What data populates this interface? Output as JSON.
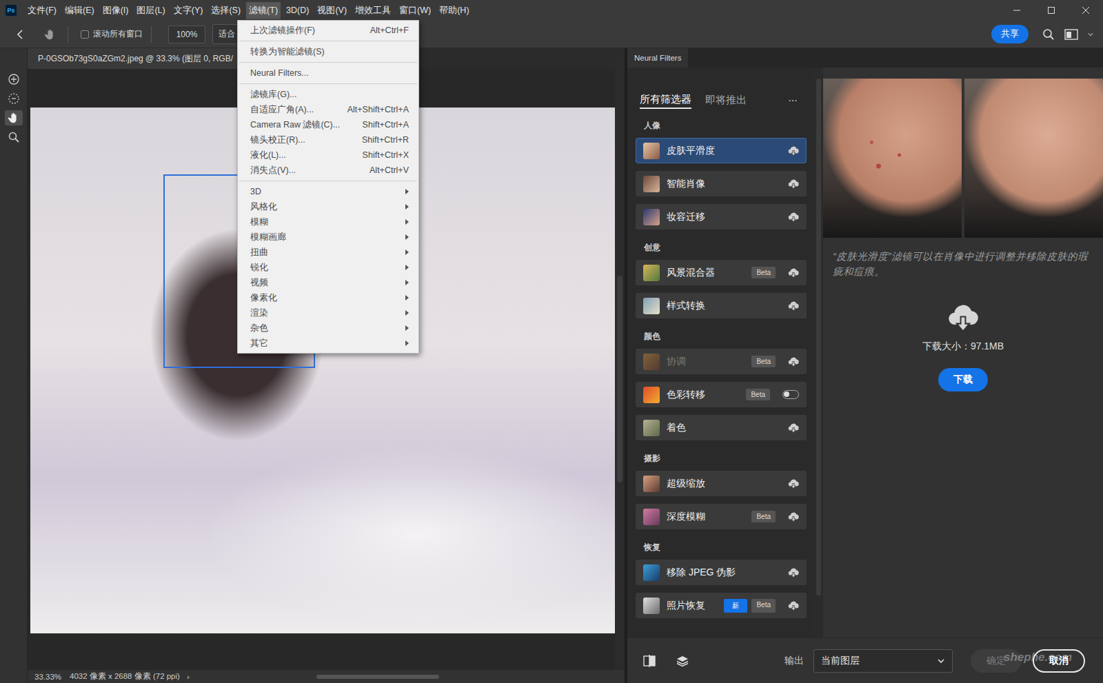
{
  "app": {
    "logo": "Ps"
  },
  "menubar": [
    {
      "label": "文件(F)",
      "selected": false
    },
    {
      "label": "编辑(E)",
      "selected": false
    },
    {
      "label": "图像(I)",
      "selected": false
    },
    {
      "label": "图层(L)",
      "selected": false
    },
    {
      "label": "文字(Y)",
      "selected": false
    },
    {
      "label": "选择(S)",
      "selected": false
    },
    {
      "label": "滤镜(T)",
      "selected": true
    },
    {
      "label": "3D(D)",
      "selected": false
    },
    {
      "label": "视图(V)",
      "selected": false
    },
    {
      "label": "增效工具",
      "selected": false
    },
    {
      "label": "窗口(W)",
      "selected": false
    },
    {
      "label": "帮助(H)",
      "selected": false
    }
  ],
  "options_bar": {
    "scroll_all_windows": {
      "label": "滚动所有窗口",
      "checked": false
    },
    "zoom": "100%",
    "fit": "适合",
    "share": "共享"
  },
  "toolbar": [
    {
      "kind": "target",
      "selected": false
    },
    {
      "kind": "lasso",
      "selected": false
    },
    {
      "kind": "hand",
      "selected": true
    },
    {
      "kind": "zoom",
      "selected": false
    }
  ],
  "document": {
    "tab": "P-0GSOb73gS0aZGm2.jpeg @ 33.3% (图层 0, RGB/",
    "zoom": "33.33%",
    "dimensions": "4032 像素 x 2688 像素 (72 ppi)",
    "more": "›"
  },
  "filter_menu": {
    "groups": [
      [
        {
          "label": "上次滤镜操作(F)",
          "shortcut": "Alt+Ctrl+F",
          "submenu": false
        }
      ],
      [
        {
          "label": "转换为智能滤镜(S)",
          "shortcut": "",
          "submenu": false
        }
      ],
      [
        {
          "label": "Neural Filters...",
          "shortcut": "",
          "submenu": false
        }
      ],
      [
        {
          "label": "滤镜库(G)...",
          "shortcut": "",
          "submenu": false
        },
        {
          "label": "自适应广角(A)...",
          "shortcut": "Alt+Shift+Ctrl+A",
          "submenu": false
        },
        {
          "label": "Camera Raw 滤镜(C)...",
          "shortcut": "Shift+Ctrl+A",
          "submenu": false
        },
        {
          "label": "镜头校正(R)...",
          "shortcut": "Shift+Ctrl+R",
          "submenu": false
        },
        {
          "label": "液化(L)...",
          "shortcut": "Shift+Ctrl+X",
          "submenu": false
        },
        {
          "label": "消失点(V)...",
          "shortcut": "Alt+Ctrl+V",
          "submenu": false
        }
      ],
      [
        {
          "label": "3D",
          "shortcut": "",
          "submenu": true
        },
        {
          "label": "风格化",
          "shortcut": "",
          "submenu": true
        },
        {
          "label": "模糊",
          "shortcut": "",
          "submenu": true
        },
        {
          "label": "模糊画廊",
          "shortcut": "",
          "submenu": true
        },
        {
          "label": "扭曲",
          "shortcut": "",
          "submenu": true
        },
        {
          "label": "锐化",
          "shortcut": "",
          "submenu": true
        },
        {
          "label": "视频",
          "shortcut": "",
          "submenu": true
        },
        {
          "label": "像素化",
          "shortcut": "",
          "submenu": true
        },
        {
          "label": "渲染",
          "shortcut": "",
          "submenu": true
        },
        {
          "label": "杂色",
          "shortcut": "",
          "submenu": true
        },
        {
          "label": "其它",
          "shortcut": "",
          "submenu": true
        }
      ]
    ]
  },
  "neural_filters": {
    "panel_tab": "Neural Filters",
    "tabs": [
      {
        "label": "所有筛选器",
        "selected": true
      },
      {
        "label": "即将推出",
        "selected": false
      }
    ],
    "more": "···",
    "categories": [
      {
        "title": "人像",
        "filters": [
          {
            "name": "皮肤平滑度",
            "selected": true,
            "disabled": false,
            "badges": [],
            "kind": "download"
          },
          {
            "name": "智能肖像",
            "selected": false,
            "disabled": false,
            "badges": [],
            "kind": "download"
          },
          {
            "name": "妆容迁移",
            "selected": false,
            "disabled": false,
            "badges": [],
            "kind": "download"
          }
        ]
      },
      {
        "title": "创意",
        "filters": [
          {
            "name": "风景混合器",
            "selected": false,
            "disabled": false,
            "badges": [
              {
                "label": "Beta",
                "kind": "beta"
              }
            ],
            "kind": "download"
          },
          {
            "name": "样式转换",
            "selected": false,
            "disabled": false,
            "badges": [],
            "kind": "download"
          }
        ]
      },
      {
        "title": "颜色",
        "filters": [
          {
            "name": "协调",
            "selected": false,
            "disabled": true,
            "badges": [
              {
                "label": "Beta",
                "kind": "beta"
              }
            ],
            "kind": "download"
          },
          {
            "name": "色彩转移",
            "selected": false,
            "disabled": false,
            "badges": [
              {
                "label": "Beta",
                "kind": "beta"
              }
            ],
            "kind": "toggle",
            "on": false
          },
          {
            "name": "着色",
            "selected": false,
            "disabled": false,
            "badges": [],
            "kind": "download"
          }
        ]
      },
      {
        "title": "摄影",
        "filters": [
          {
            "name": "超级缩放",
            "selected": false,
            "disabled": false,
            "badges": [],
            "kind": "download"
          },
          {
            "name": "深度模糊",
            "selected": false,
            "disabled": false,
            "badges": [
              {
                "label": "Beta",
                "kind": "beta"
              }
            ],
            "kind": "download"
          }
        ]
      },
      {
        "title": "恢复",
        "filters": [
          {
            "name": "移除 JPEG 伪影",
            "selected": false,
            "disabled": false,
            "badges": [],
            "kind": "download"
          },
          {
            "name": "照片恢复",
            "selected": false,
            "disabled": false,
            "badges": [
              {
                "label": "新",
                "kind": "new"
              },
              {
                "label": "Beta",
                "kind": "beta"
              }
            ],
            "kind": "download"
          }
        ]
      }
    ],
    "preview": {
      "description": "“皮肤光滑度”滤镜可以在肖像中进行调整并移除皮肤的瑕疵和痘痕。",
      "download_size": "下载大小：97.1MB",
      "download_button": "下载"
    },
    "footer": {
      "output_label": "输出",
      "output_value": "当前图层",
      "ok": {
        "label": "确定",
        "disabled": true
      },
      "cancel": "取消"
    }
  },
  "watermark": "shephe.com"
}
